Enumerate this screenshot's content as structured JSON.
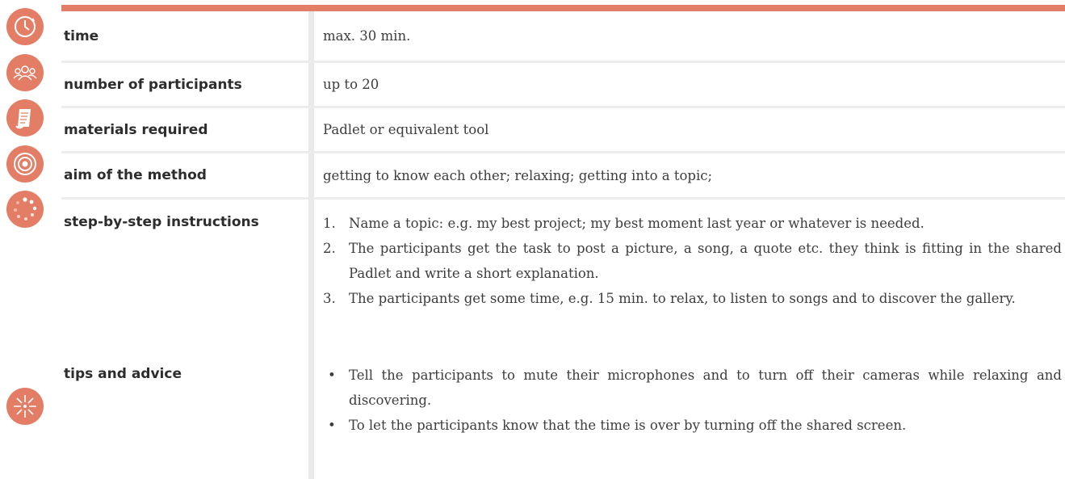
{
  "colors": {
    "accent": "#e47d65",
    "separator": "#e9e9e9"
  },
  "rows": [
    {
      "icon": "clock-icon",
      "label": "time",
      "value": "max. 30 min."
    },
    {
      "icon": "participants-icon",
      "label": "number of participants",
      "value": "up to 20"
    },
    {
      "icon": "document-icon",
      "label": "materials required",
      "value": "Padlet or equivalent tool"
    },
    {
      "icon": "target-icon",
      "label": "aim of the method",
      "value": "getting to know each other; relaxing; getting into a topic;"
    },
    {
      "icon": "steps-icon",
      "label": "step-by-step instructions",
      "steps": [
        "Name a topic: e.g. my best project; my best moment last year or whatever is needed.",
        "The participants get the task to post a picture, a song, a quote etc. they think is fitting in the shared Padlet and write a short explanation.",
        "The participants get some time, e.g. 15 min. to relax, to listen to songs and to discover the gallery."
      ],
      "step_numbers": [
        "1.",
        "2.",
        "3."
      ]
    },
    {
      "icon": "sparkle-icon",
      "label": "tips and advice",
      "tips": [
        "Tell the participants to mute their microphones and to turn off their cameras while relaxing and discovering.",
        "To let the participants know that the time is over by turning off the shared screen."
      ],
      "bullet": "•"
    }
  ]
}
